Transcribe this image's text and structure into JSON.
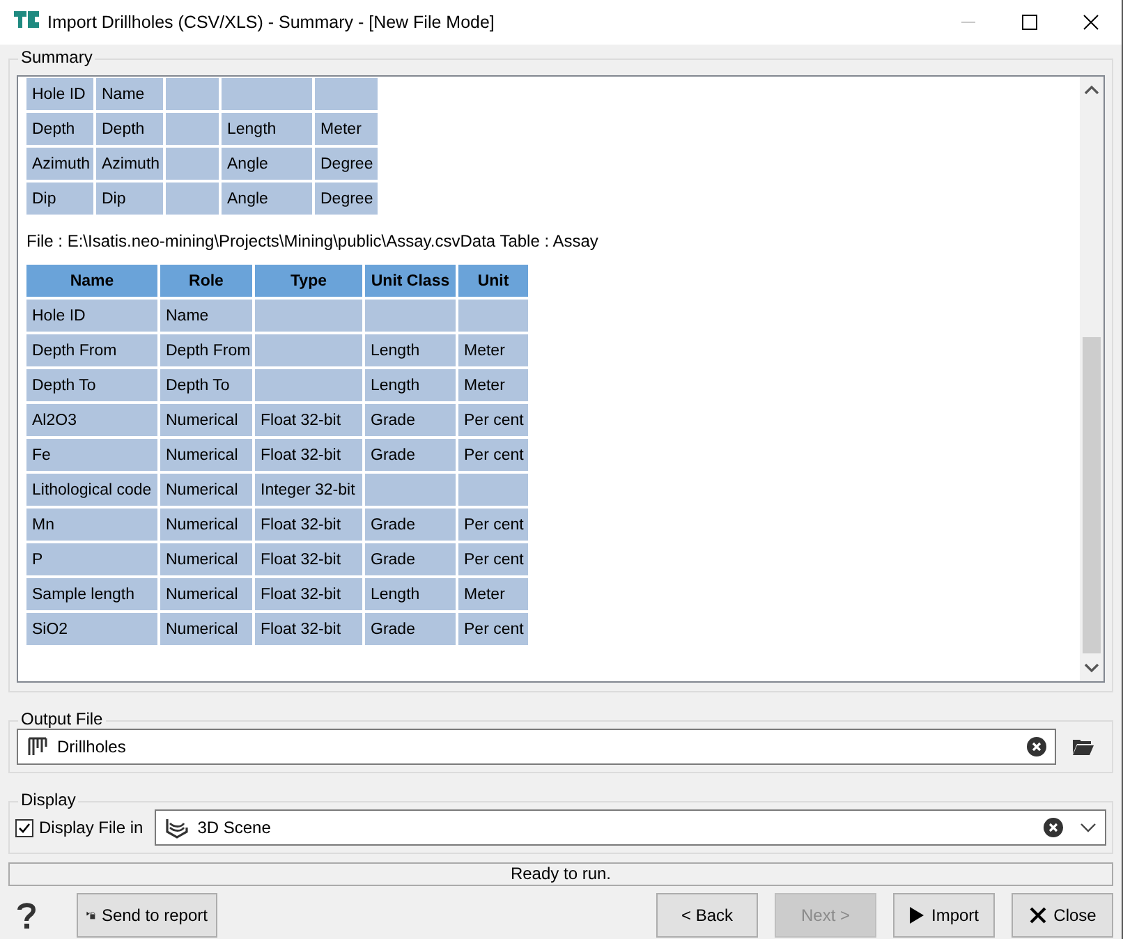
{
  "window": {
    "title": "Import Drillholes (CSV/XLS) - Summary - [New File Mode]"
  },
  "summary": {
    "label": "Summary",
    "fields_rows": [
      [
        "Hole ID",
        "Name",
        "",
        "",
        ""
      ],
      [
        "Depth",
        "Depth",
        "",
        "Length",
        "Meter"
      ],
      [
        "Azimuth",
        "Azimuth",
        "",
        "Angle",
        "Degree"
      ],
      [
        "Dip",
        "Dip",
        "",
        "Angle",
        "Degree"
      ]
    ],
    "file_line": "File : E:\\Isatis.neo-mining\\Projects\\Mining\\public\\Assay.csvData Table : Assay",
    "table": {
      "columns": [
        "Name",
        "Role",
        "Type",
        "Unit Class",
        "Unit"
      ],
      "rows": [
        [
          "Hole ID",
          "Name",
          "",
          "",
          ""
        ],
        [
          "Depth From",
          "Depth From",
          "",
          "Length",
          "Meter"
        ],
        [
          "Depth To",
          "Depth To",
          "",
          "Length",
          "Meter"
        ],
        [
          "Al2O3",
          "Numerical",
          "Float 32-bit",
          "Grade",
          "Per cent"
        ],
        [
          "Fe",
          "Numerical",
          "Float 32-bit",
          "Grade",
          "Per cent"
        ],
        [
          "Lithological code",
          "Numerical",
          "Integer 32-bit",
          "",
          ""
        ],
        [
          "Mn",
          "Numerical",
          "Float 32-bit",
          "Grade",
          "Per cent"
        ],
        [
          "P",
          "Numerical",
          "Float 32-bit",
          "Grade",
          "Per cent"
        ],
        [
          "Sample length",
          "Numerical",
          "Float 32-bit",
          "Length",
          "Meter"
        ],
        [
          "SiO2",
          "Numerical",
          "Float 32-bit",
          "Grade",
          "Per cent"
        ]
      ]
    }
  },
  "output_file": {
    "label": "Output File",
    "value": "Drillholes"
  },
  "display": {
    "label": "Display",
    "checkbox": {
      "label": "Display File in",
      "checked": true
    },
    "scene": {
      "value": "3D Scene"
    }
  },
  "status": "Ready to run.",
  "buttons": [
    {
      "kind": "report",
      "label": "Send to report",
      "disabled": false
    },
    {
      "kind": "back",
      "label": "< Back",
      "disabled": false
    },
    {
      "kind": "next",
      "label": "Next >",
      "disabled": true
    },
    {
      "kind": "import",
      "label": "Import",
      "disabled": false
    },
    {
      "kind": "close",
      "label": "Close",
      "disabled": false
    }
  ]
}
